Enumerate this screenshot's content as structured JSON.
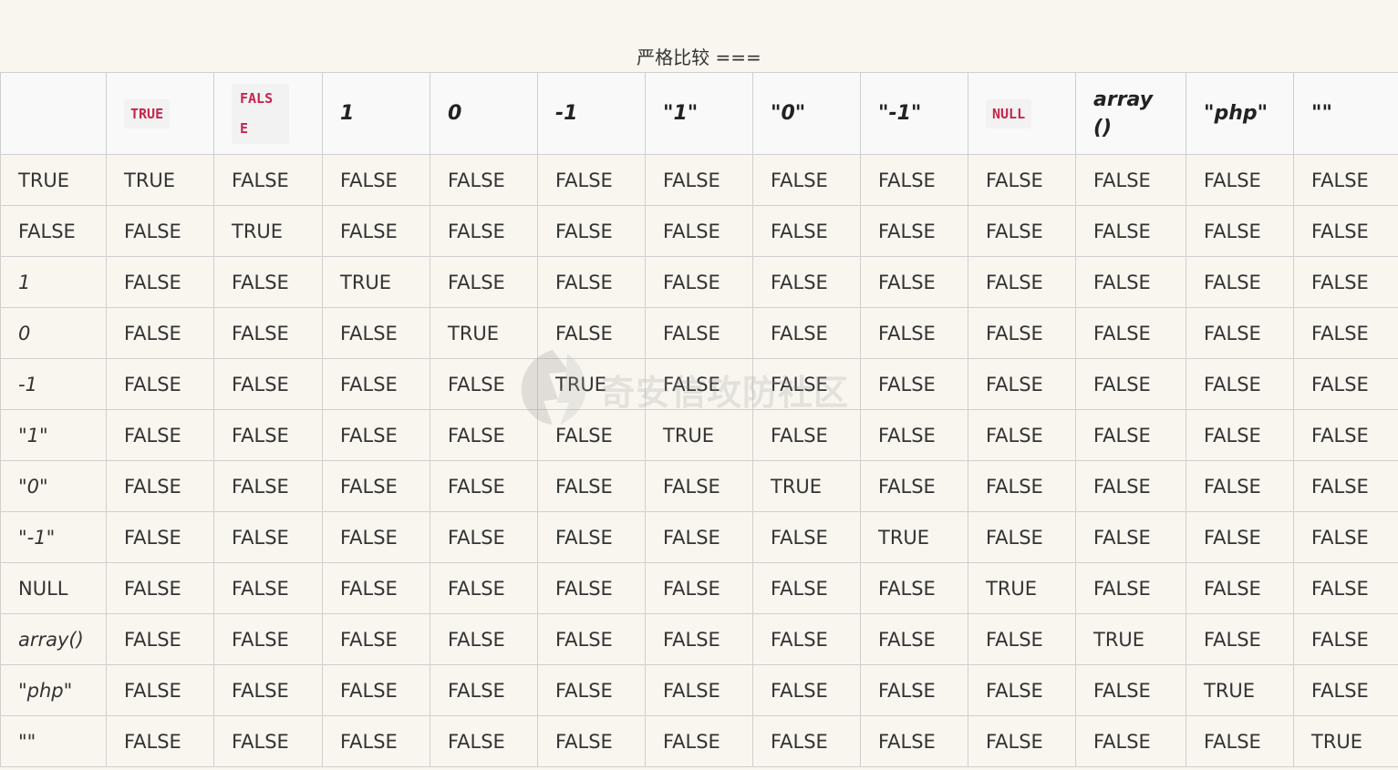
{
  "caption": "严格比较 ===",
  "header": [
    {
      "label": "",
      "code": false,
      "italic": false
    },
    {
      "label": "TRUE",
      "code": true
    },
    {
      "label": "FALSE",
      "code": true,
      "wrap": true
    },
    {
      "label": "1",
      "code": false
    },
    {
      "label": "0",
      "code": false
    },
    {
      "label": "-1",
      "code": false
    },
    {
      "label": "\"1\"",
      "code": false
    },
    {
      "label": "\"0\"",
      "code": false
    },
    {
      "label": "\"-1\"",
      "code": false
    },
    {
      "label": "NULL",
      "code": true
    },
    {
      "label": "array()",
      "code": false,
      "arr": true
    },
    {
      "label": "\"php\"",
      "code": false
    },
    {
      "label": "\"\"",
      "code": false
    }
  ],
  "rows": [
    {
      "head": "TRUE",
      "italic": false,
      "cells": [
        "TRUE",
        "FALSE",
        "FALSE",
        "FALSE",
        "FALSE",
        "FALSE",
        "FALSE",
        "FALSE",
        "FALSE",
        "FALSE",
        "FALSE",
        "FALSE"
      ]
    },
    {
      "head": "FALSE",
      "italic": false,
      "cells": [
        "FALSE",
        "TRUE",
        "FALSE",
        "FALSE",
        "FALSE",
        "FALSE",
        "FALSE",
        "FALSE",
        "FALSE",
        "FALSE",
        "FALSE",
        "FALSE"
      ]
    },
    {
      "head": "1",
      "italic": true,
      "cells": [
        "FALSE",
        "FALSE",
        "TRUE",
        "FALSE",
        "FALSE",
        "FALSE",
        "FALSE",
        "FALSE",
        "FALSE",
        "FALSE",
        "FALSE",
        "FALSE"
      ]
    },
    {
      "head": "0",
      "italic": true,
      "cells": [
        "FALSE",
        "FALSE",
        "FALSE",
        "TRUE",
        "FALSE",
        "FALSE",
        "FALSE",
        "FALSE",
        "FALSE",
        "FALSE",
        "FALSE",
        "FALSE"
      ]
    },
    {
      "head": "-1",
      "italic": true,
      "cells": [
        "FALSE",
        "FALSE",
        "FALSE",
        "FALSE",
        "TRUE",
        "FALSE",
        "FALSE",
        "FALSE",
        "FALSE",
        "FALSE",
        "FALSE",
        "FALSE"
      ]
    },
    {
      "head": "\"1\"",
      "italic": true,
      "cells": [
        "FALSE",
        "FALSE",
        "FALSE",
        "FALSE",
        "FALSE",
        "TRUE",
        "FALSE",
        "FALSE",
        "FALSE",
        "FALSE",
        "FALSE",
        "FALSE"
      ]
    },
    {
      "head": "\"0\"",
      "italic": true,
      "cells": [
        "FALSE",
        "FALSE",
        "FALSE",
        "FALSE",
        "FALSE",
        "FALSE",
        "TRUE",
        "FALSE",
        "FALSE",
        "FALSE",
        "FALSE",
        "FALSE"
      ]
    },
    {
      "head": "\"-1\"",
      "italic": true,
      "cells": [
        "FALSE",
        "FALSE",
        "FALSE",
        "FALSE",
        "FALSE",
        "FALSE",
        "FALSE",
        "TRUE",
        "FALSE",
        "FALSE",
        "FALSE",
        "FALSE"
      ]
    },
    {
      "head": "NULL",
      "italic": false,
      "cells": [
        "FALSE",
        "FALSE",
        "FALSE",
        "FALSE",
        "FALSE",
        "FALSE",
        "FALSE",
        "FALSE",
        "TRUE",
        "FALSE",
        "FALSE",
        "FALSE"
      ]
    },
    {
      "head": "array()",
      "italic": true,
      "cells": [
        "FALSE",
        "FALSE",
        "FALSE",
        "FALSE",
        "FALSE",
        "FALSE",
        "FALSE",
        "FALSE",
        "FALSE",
        "TRUE",
        "FALSE",
        "FALSE"
      ]
    },
    {
      "head": "\"php\"",
      "italic": true,
      "cells": [
        "FALSE",
        "FALSE",
        "FALSE",
        "FALSE",
        "FALSE",
        "FALSE",
        "FALSE",
        "FALSE",
        "FALSE",
        "FALSE",
        "TRUE",
        "FALSE"
      ]
    },
    {
      "head": "\"\"",
      "italic": true,
      "cells": [
        "FALSE",
        "FALSE",
        "FALSE",
        "FALSE",
        "FALSE",
        "FALSE",
        "FALSE",
        "FALSE",
        "FALSE",
        "FALSE",
        "FALSE",
        "TRUE"
      ]
    }
  ],
  "watermark": {
    "text": "奇安信攻防社区",
    "icon": "lightning-logo-icon"
  }
}
